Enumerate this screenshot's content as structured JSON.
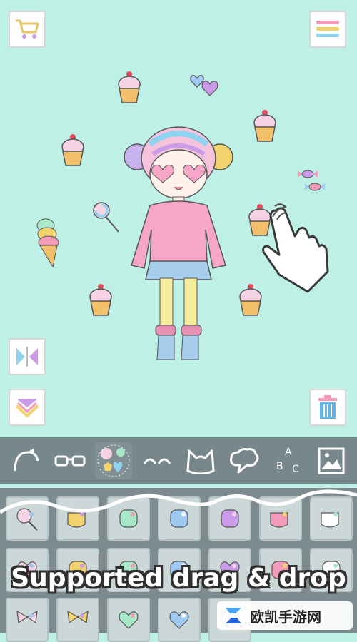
{
  "toolbar": {
    "cart_icon": "cart-icon",
    "menu_icon": "menu-icon",
    "flip_icon": "flip-icon",
    "layer_down_icon": "layer-down-icon",
    "trash_icon": "trash-icon"
  },
  "tabs": [
    {
      "icon": "headband-icon"
    },
    {
      "icon": "glasses-icon"
    },
    {
      "icon": "sticker-icon",
      "active": true
    },
    {
      "icon": "eyes-icon"
    },
    {
      "icon": "cat-ears-icon"
    },
    {
      "icon": "speech-bubble-icon"
    },
    {
      "icon": "letters-icon",
      "text": "A B C"
    },
    {
      "icon": "background-image-icon"
    }
  ],
  "items": [
    "lollipop-icon",
    "cupcake-icon",
    "pouch-icon",
    "candy-icon",
    "ice-cream-icon",
    "teacup-icon",
    "mug-icon",
    "heart-lollipop-icon",
    "envelope-icon",
    "cookie-icon",
    "candies-icon",
    "heart-frame-icon",
    "macaron-icon",
    "flower-icon",
    "bow-icon",
    "bow-icon",
    "hearts-icon",
    "drip-heart-icon",
    "hearts-icon"
  ],
  "caption": "Supported drag & drop",
  "watermark": "欧凯手游网",
  "colors": {
    "background": "#bff0e6",
    "tabbar": "#78878b",
    "grid": "#7d8b90"
  }
}
